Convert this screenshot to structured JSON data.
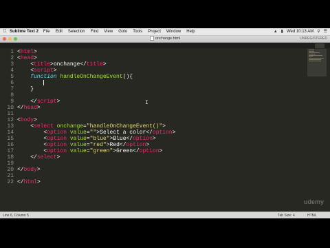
{
  "menubar": {
    "app_name": "Sublime Text 2",
    "items": [
      "File",
      "Edit",
      "Selection",
      "Find",
      "View",
      "Goto",
      "Tools",
      "Project",
      "Window",
      "Help"
    ],
    "clock": "Wed 10:13 AM"
  },
  "window": {
    "file_title": "onchange.html",
    "unregistered": "UNREGISTERED"
  },
  "tabbar": {
    "active_tab": ""
  },
  "gutter": {
    "line_numbers": [
      "1",
      "2",
      "3",
      "4",
      "5",
      "6",
      "7",
      "8",
      "9",
      "10",
      "11",
      "12",
      "13",
      "14",
      "15",
      "16",
      "17",
      "18",
      "19",
      "20",
      "21",
      "22"
    ]
  },
  "code": {
    "lines": [
      [
        {
          "t": "<",
          "c": "p"
        },
        {
          "t": "html",
          "c": "tag"
        },
        {
          "t": ">",
          "c": "p"
        }
      ],
      [
        {
          "t": "<",
          "c": "p"
        },
        {
          "t": "head",
          "c": "tag"
        },
        {
          "t": ">",
          "c": "p"
        }
      ],
      [
        {
          "t": "    <",
          "c": "p"
        },
        {
          "t": "title",
          "c": "tag"
        },
        {
          "t": ">onchange</",
          "c": "p"
        },
        {
          "t": "title",
          "c": "tag"
        },
        {
          "t": ">",
          "c": "p"
        }
      ],
      [
        {
          "t": "    <",
          "c": "p"
        },
        {
          "t": "script",
          "c": "tag"
        },
        {
          "t": ">",
          "c": "p"
        }
      ],
      [
        {
          "t": "    ",
          "c": "p"
        },
        {
          "t": "function",
          "c": "kw"
        },
        {
          "t": " ",
          "c": "p"
        },
        {
          "t": "handleOnChangeEvent",
          "c": "fn"
        },
        {
          "t": "(){",
          "c": "p"
        }
      ],
      [
        {
          "t": "        ",
          "c": "p"
        }
      ],
      [
        {
          "t": "    }",
          "c": "p"
        }
      ],
      [],
      [
        {
          "t": "    </",
          "c": "p"
        },
        {
          "t": "script",
          "c": "tag"
        },
        {
          "t": ">",
          "c": "p"
        }
      ],
      [
        {
          "t": "</",
          "c": "p"
        },
        {
          "t": "head",
          "c": "tag"
        },
        {
          "t": ">",
          "c": "p"
        }
      ],
      [],
      [
        {
          "t": "<",
          "c": "p"
        },
        {
          "t": "body",
          "c": "tag"
        },
        {
          "t": ">",
          "c": "p"
        }
      ],
      [
        {
          "t": "    <",
          "c": "p"
        },
        {
          "t": "select",
          "c": "tag"
        },
        {
          "t": " ",
          "c": "p"
        },
        {
          "t": "onchange",
          "c": "attr"
        },
        {
          "t": "=",
          "c": "p"
        },
        {
          "t": "\"handleOnChangeEvent()\"",
          "c": "str"
        },
        {
          "t": ">",
          "c": "p"
        }
      ],
      [
        {
          "t": "        <",
          "c": "p"
        },
        {
          "t": "option",
          "c": "tag"
        },
        {
          "t": " ",
          "c": "p"
        },
        {
          "t": "value",
          "c": "attr"
        },
        {
          "t": "=",
          "c": "p"
        },
        {
          "t": "\"\"",
          "c": "str"
        },
        {
          "t": ">Select a color</",
          "c": "p"
        },
        {
          "t": "option",
          "c": "tag"
        },
        {
          "t": ">",
          "c": "p"
        }
      ],
      [
        {
          "t": "        <",
          "c": "p"
        },
        {
          "t": "option",
          "c": "tag"
        },
        {
          "t": " ",
          "c": "p"
        },
        {
          "t": "value",
          "c": "attr"
        },
        {
          "t": "=",
          "c": "p"
        },
        {
          "t": "\"blue\"",
          "c": "str"
        },
        {
          "t": ">Blue</",
          "c": "p"
        },
        {
          "t": "option",
          "c": "tag"
        },
        {
          "t": ">",
          "c": "p"
        }
      ],
      [
        {
          "t": "        <",
          "c": "p"
        },
        {
          "t": "option",
          "c": "tag"
        },
        {
          "t": " ",
          "c": "p"
        },
        {
          "t": "value",
          "c": "attr"
        },
        {
          "t": "=",
          "c": "p"
        },
        {
          "t": "\"red\"",
          "c": "str"
        },
        {
          "t": ">Red</",
          "c": "p"
        },
        {
          "t": "option",
          "c": "tag"
        },
        {
          "t": ">",
          "c": "p"
        }
      ],
      [
        {
          "t": "        <",
          "c": "p"
        },
        {
          "t": "option",
          "c": "tag"
        },
        {
          "t": " ",
          "c": "p"
        },
        {
          "t": "value",
          "c": "attr"
        },
        {
          "t": "=",
          "c": "p"
        },
        {
          "t": "\"green\"",
          "c": "str"
        },
        {
          "t": ">Green</",
          "c": "p"
        },
        {
          "t": "option",
          "c": "tag"
        },
        {
          "t": ">",
          "c": "p"
        }
      ],
      [
        {
          "t": "    </",
          "c": "p"
        },
        {
          "t": "select",
          "c": "tag"
        },
        {
          "t": ">",
          "c": "p"
        }
      ],
      [],
      [
        {
          "t": "</",
          "c": "p"
        },
        {
          "t": "body",
          "c": "tag"
        },
        {
          "t": ">",
          "c": "p"
        }
      ],
      [],
      [
        {
          "t": "</",
          "c": "p"
        },
        {
          "t": "html",
          "c": "tag"
        },
        {
          "t": ">",
          "c": "p"
        }
      ]
    ],
    "cursor_line": 6
  },
  "statusbar": {
    "position": "Line 6, Column 5",
    "tab_size": "Tab Size: 4",
    "syntax": "HTML"
  },
  "watermark": "udemy",
  "colors": {
    "editor_bg": "#272822",
    "tag": "#f92672",
    "attr": "#a6e22e",
    "string": "#e6db74",
    "keyword": "#66d9ef",
    "text": "#f8f8f2"
  }
}
